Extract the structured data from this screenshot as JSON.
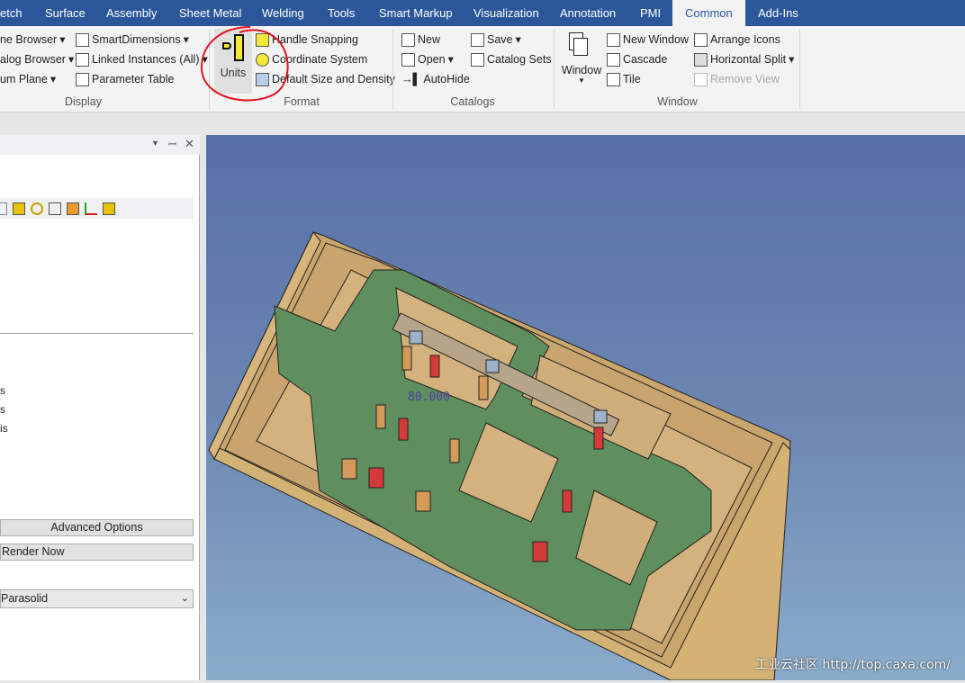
{
  "tabs": [
    {
      "label": "etch"
    },
    {
      "label": "Surface"
    },
    {
      "label": "Assembly"
    },
    {
      "label": "Sheet Metal"
    },
    {
      "label": "Welding"
    },
    {
      "label": "Tools"
    },
    {
      "label": "Smart Markup"
    },
    {
      "label": "Visualization"
    },
    {
      "label": "Annotation"
    },
    {
      "label": "PMI"
    },
    {
      "label": "Common",
      "active": true
    },
    {
      "label": "Add-Ins"
    }
  ],
  "ribbon": {
    "display": {
      "label": "Display",
      "items": [
        "ne Browser",
        "alog Browser",
        "um Plane",
        "SmartDimensions",
        "Linked Instances (All)",
        "Parameter Table"
      ]
    },
    "format": {
      "label": "Format",
      "units": "Units",
      "items": [
        "Handle Snapping",
        "Coordinate System",
        "Default Size and Density"
      ]
    },
    "catalogs": {
      "label": "Catalogs",
      "items": [
        "New",
        "Open",
        "AutoHide",
        "Save",
        "Catalog Sets"
      ]
    },
    "window": {
      "label": "Window",
      "window_button": "Window",
      "items": [
        "New Window",
        "Cascade",
        "Tile",
        "Arrange Icons",
        "Horizontal Split",
        "Remove View"
      ]
    }
  },
  "panel": {
    "rows": [
      "s",
      "s",
      "is"
    ],
    "advanced": "Advanced Options",
    "render": "Render Now",
    "select": "Parasolid"
  },
  "viewport": {
    "dimension": "80.000",
    "watermark": "工业云社区 http://top.caxa.com/"
  },
  "colors": {
    "tab_bar": "#2b579a",
    "annotation_circle": "#e0141e",
    "part_green": "#5e8c5e",
    "box_tan": "#d9b77d"
  }
}
